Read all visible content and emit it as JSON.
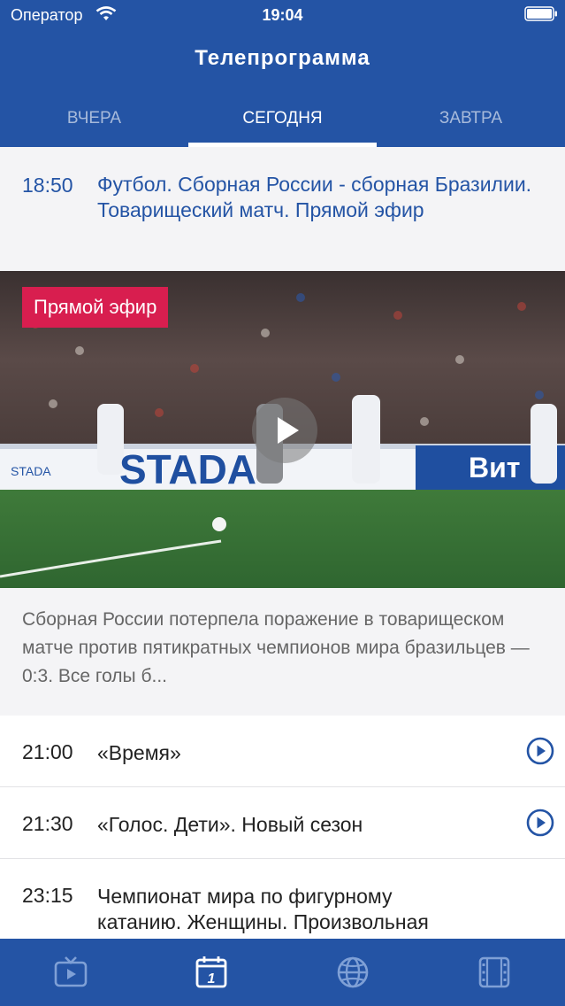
{
  "status_bar": {
    "carrier": "Оператор",
    "time": "19:04"
  },
  "header": {
    "title": "Телепрограмма"
  },
  "tabs": [
    {
      "label": "ВЧЕРА",
      "active": false
    },
    {
      "label": "СЕГОДНЯ",
      "active": true
    },
    {
      "label": "ЗАВТРА",
      "active": false
    }
  ],
  "live_program": {
    "time": "18:50",
    "title": "Футбол. Сборная России - сборная Бразилии. Товарищеский матч. Прямой эфир",
    "badge": "Прямой эфир",
    "description": "Сборная России потерпела поражение в товарищеском матче против пятикратных чемпионов мира бразильцев — 0:3. Все голы б...",
    "ad_board_left": "STADA",
    "ad_board_main": "STADA",
    "ad_board_right": "Вит"
  },
  "programs": [
    {
      "time": "21:00",
      "title": "«Время»"
    },
    {
      "time": "21:30",
      "title": "«Голос. Дети». Новый сезон"
    },
    {
      "time": "23:15",
      "title": "Чемпионат мира по фигурному катанию. Женщины. Произвольная программа. Прямой эфир"
    }
  ],
  "tabbar": {
    "items": [
      {
        "icon": "tv-icon"
      },
      {
        "icon": "calendar-icon",
        "day": "1"
      },
      {
        "icon": "globe-icon"
      },
      {
        "icon": "film-icon"
      }
    ]
  },
  "colors": {
    "brand_blue": "#2454a5",
    "live_red": "#d81e4f",
    "page_bg": "#f4f4f6"
  }
}
